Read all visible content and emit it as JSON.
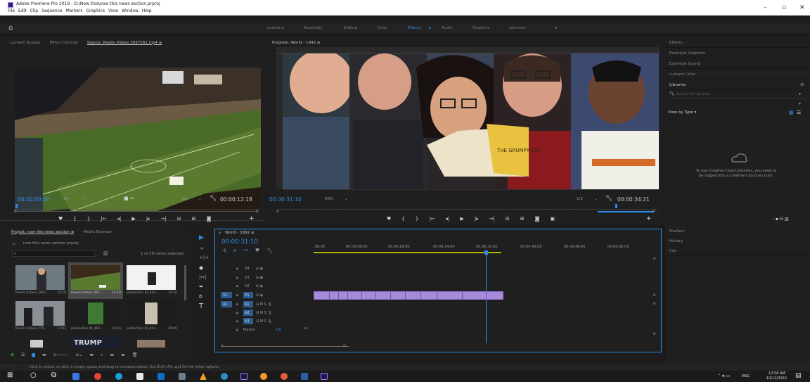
{
  "window": {
    "title": "Adobe Premiere Pro 2019 - D:\\Now this\\now this news section.prproj",
    "minimize": "–",
    "maximize": "▫",
    "close": "✕"
  },
  "menu": [
    "File",
    "Edit",
    "Clip",
    "Sequence",
    "Markers",
    "Graphics",
    "View",
    "Window",
    "Help"
  ],
  "workspaces": [
    "Learning",
    "Assembly",
    "Editing",
    "Color",
    "Effects",
    "≡",
    "Audio",
    "Graphics",
    "Libraries",
    "»"
  ],
  "source_panel": {
    "tabs": [
      "Lumetri Scopes",
      "Effect Controls",
      "Source: Pexels Videos 2657261.mp4  ≡"
    ],
    "timecode": "00:00:00:00",
    "fit": "Fit",
    "resolution": "1/2",
    "duration": "00:00:12:18"
  },
  "program_panel": {
    "tab": "Program: World - 1992  ≡",
    "timecode": "00:00:31:10",
    "zoom": "50%",
    "resolution": "1/2",
    "duration": "00:00:34:21",
    "book_text": "THE GRUMPY BOY"
  },
  "right_panel": {
    "items": [
      "Effects",
      "Essential Graphics",
      "Essential Sound",
      "Lumetri Color",
      "Libraries"
    ],
    "search_placeholder": "Search All Libraries",
    "view_by": "View by Type ▾",
    "cc_message": "To use Creative Cloud Libraries, you need to be logged into a Creative Cloud account.",
    "bottom_items": [
      "Markers",
      "History",
      "Info"
    ]
  },
  "project_panel": {
    "tabs": [
      "Project: now this news section  ≡",
      "Media Browser"
    ],
    "folder": "now this news section.prproj",
    "items_count": "1 of 29 items selected",
    "items": [
      {
        "name": "Pexels Videos 2902...",
        "dur": "15:10"
      },
      {
        "name": "Pexels Videos 265...",
        "dur": "12:18"
      },
      {
        "name": "production ID_394...",
        "dur": "14:16"
      },
      {
        "name": "Pexels Videos 270...",
        "dur": "13:03"
      },
      {
        "name": "production ID_403...",
        "dur": "14:16"
      },
      {
        "name": "production ID_403...",
        "dur": "39:06"
      }
    ],
    "thumb_text": "TRUMP"
  },
  "timeline": {
    "tab": "World - 1992  ≡",
    "timecode": "00:00:31:10",
    "ruler": [
      ":00:00",
      "00:00:08:00",
      "00:00:16:00",
      "00:00:24:00",
      "00:00:32:00",
      "00:00:40:00",
      "00:00:48:00",
      "00:00:56:00"
    ],
    "video_tracks": [
      "V4",
      "V3",
      "V2",
      "V1"
    ],
    "audio_tracks": [
      "A1",
      "A2",
      "A3"
    ],
    "master": "Master",
    "master_val": "0.0",
    "source_v": "V1",
    "source_a": "A1"
  },
  "status": "Click to select, or click in empty space and drag to marquee select. Use Shift, Alt, and Ctrl for other options.",
  "taskbar": {
    "time": "12:58 AM",
    "date": "10/12/2020",
    "lang": "ENG"
  },
  "colors": {
    "accent": "#2d8ceb",
    "clip": "#a68bda",
    "bg": "#1d1d1d"
  }
}
